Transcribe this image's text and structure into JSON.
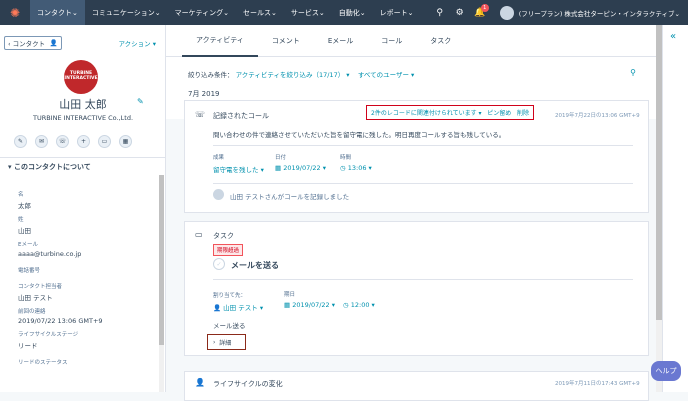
{
  "topnav": {
    "items": [
      "コンタクト",
      "コミュニケーション",
      "マーケティング",
      "セールス",
      "サービス",
      "自動化",
      "レポート"
    ],
    "notifications": "1",
    "account": "(フリープラン) 株式会社ターピン・インタラクティブ"
  },
  "left": {
    "back_label": "コンタクト",
    "actions_label": "アクション",
    "logo_text": "TURBINE INTERACTIVE",
    "name": "山田 太郎",
    "company": "TURBINE INTERACTIVE Co.,Ltd.",
    "about_title": "このコンタクトについて",
    "fields": [
      {
        "label": "名",
        "value": "太郎"
      },
      {
        "label": "姓",
        "value": "山田"
      },
      {
        "label": "Eメール",
        "value": "aaaa@turbine.co.jp"
      },
      {
        "label": "電話番号",
        "value": ""
      },
      {
        "label": "コンタクト担当者",
        "value": "山田 テスト"
      },
      {
        "label": "前回の連絡",
        "value": "2019/07/22 13:06 GMT+9"
      },
      {
        "label": "ライフサイクルステージ",
        "value": "リード"
      },
      {
        "label": "リードのステータス",
        "value": ""
      }
    ]
  },
  "tabs": [
    "アクティビティ",
    "コメント",
    "Eメール",
    "コール",
    "タスク"
  ],
  "filter": {
    "label": "絞り込み条件：",
    "activity_filter": "アクティビティを絞り込み（17/17）",
    "users_filter": "すべてのユーザー"
  },
  "month": "7月 2019",
  "call": {
    "title": "記録されたコール",
    "associated": "2件のレコードに関連付けられています",
    "pin": "ピン留め",
    "delete": "削除",
    "timestamp": "2019年7月22日の13:06 GMT+9",
    "body": "問い合わせの件で連絡させていただいた旨を留守電に残した。明日再度コールする旨も残している。",
    "outcome_label": "成果",
    "outcome_value": "留守電を残した",
    "date_label": "日付",
    "date_value": "2019/07/22",
    "time_label": "時間",
    "time_value": "13:06",
    "footer": "山田 テストさんがコールを記録しました"
  },
  "task": {
    "title": "タスク",
    "badge": "期限超過",
    "name": "メールを送る",
    "assignee_label": "割り当て先：",
    "assignee_value": "山田 テスト",
    "due_label": "期日",
    "due_date": "2019/07/22",
    "due_time": "12:00",
    "note": "メール送る",
    "details": "詳細"
  },
  "lifecycle": {
    "title": "ライフサイクルの変化",
    "timestamp": "2019年7月11日の17:43 GMT+9"
  },
  "help_label": "ヘルプ"
}
